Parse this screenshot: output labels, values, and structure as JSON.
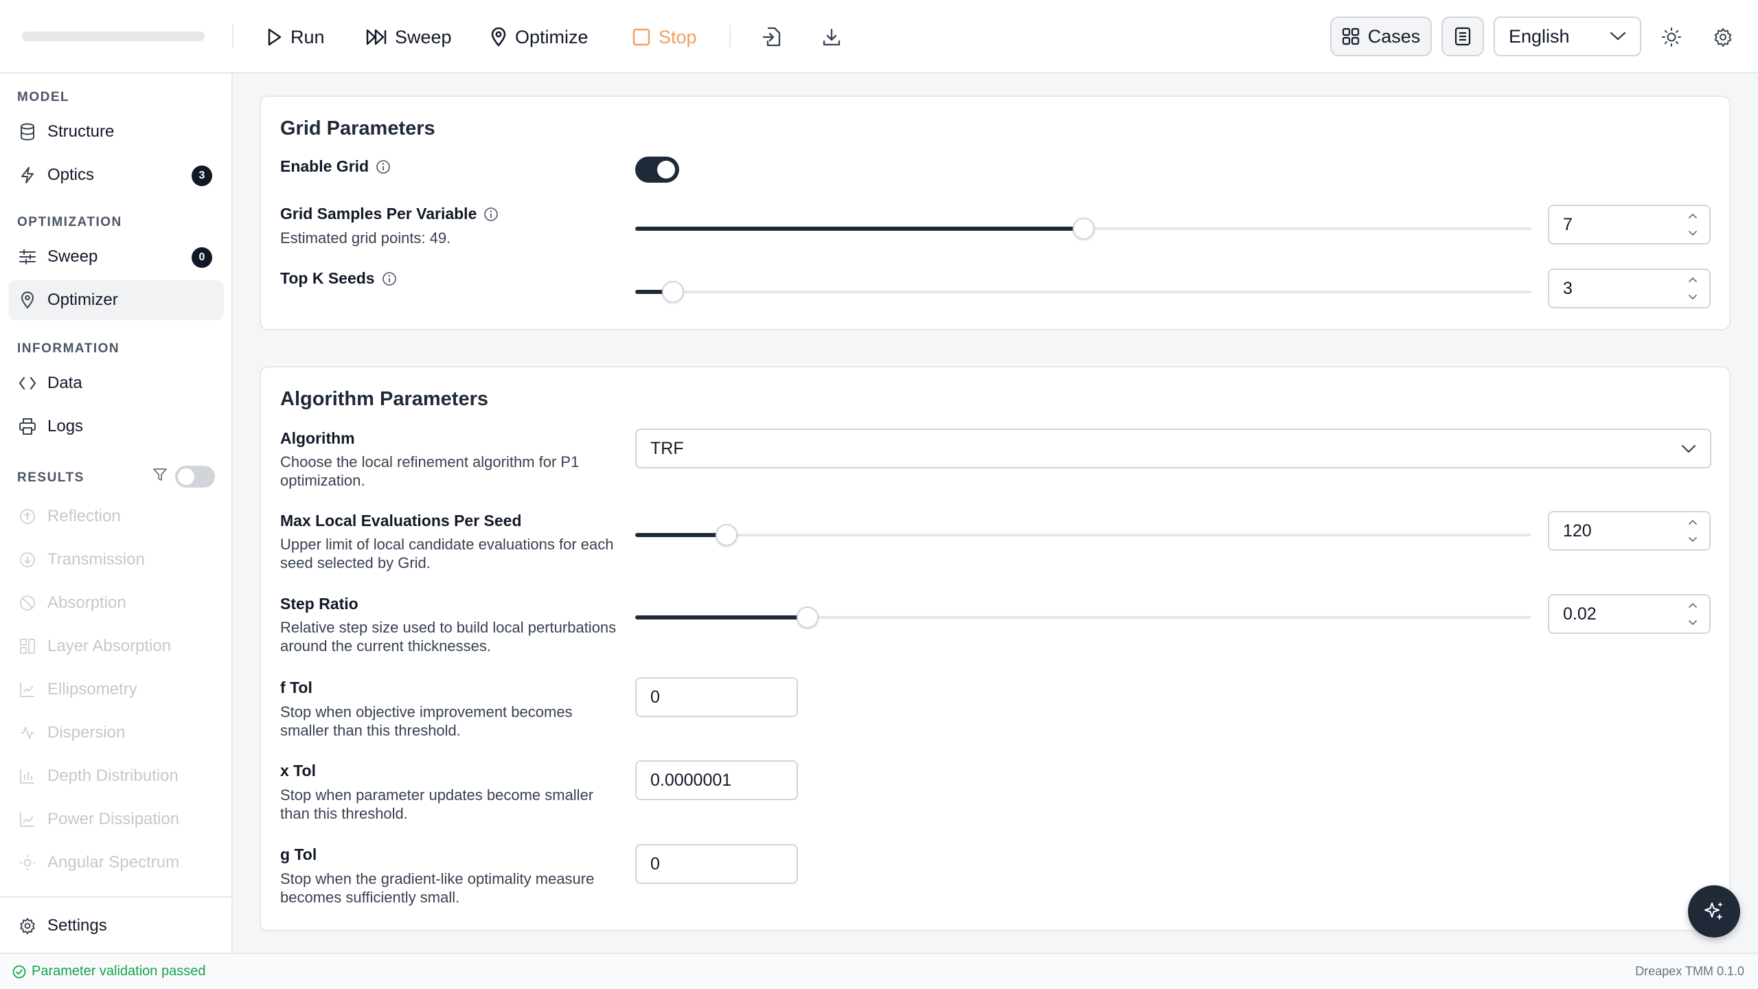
{
  "toolbar": {
    "run": "Run",
    "sweep": "Sweep",
    "optimize": "Optimize",
    "stop": "Stop",
    "cases": "Cases",
    "language": "English"
  },
  "sidebar": {
    "model_section": "MODEL",
    "structure": "Structure",
    "optics": "Optics",
    "optics_badge": "3",
    "optimization_section": "OPTIMIZATION",
    "sweep": "Sweep",
    "sweep_badge": "0",
    "optimizer": "Optimizer",
    "information_section": "INFORMATION",
    "data": "Data",
    "logs": "Logs",
    "results_section": "RESULTS",
    "results": [
      "Reflection",
      "Transmission",
      "Absorption",
      "Layer Absorption",
      "Ellipsometry",
      "Dispersion",
      "Depth Distribution",
      "Power Dissipation",
      "Angular Spectrum"
    ],
    "settings": "Settings"
  },
  "grid_card": {
    "title": "Grid Parameters",
    "enable_grid_label": "Enable Grid",
    "enable_grid_on": true,
    "samples_label": "Grid Samples Per Variable",
    "samples_desc": "Estimated grid points: 49.",
    "samples_value": "7",
    "samples_fraction": 0.5,
    "topk_label": "Top K Seeds",
    "topk_value": "3",
    "topk_fraction": 0.042
  },
  "algo_card": {
    "title": "Algorithm Parameters",
    "algorithm_label": "Algorithm",
    "algorithm_desc": "Choose the local refinement algorithm for P1 optimization.",
    "algorithm_value": "TRF",
    "max_eval_label": "Max Local Evaluations Per Seed",
    "max_eval_desc": "Upper limit of local candidate evaluations for each seed selected by Grid.",
    "max_eval_value": "120",
    "max_eval_fraction": 0.102,
    "step_label": "Step Ratio",
    "step_desc": "Relative step size used to build local perturbations around the current thicknesses.",
    "step_value": "0.02",
    "step_fraction": 0.192,
    "ftol_label": "f Tol",
    "ftol_desc": "Stop when objective improvement becomes smaller than this threshold.",
    "ftol_value": "0",
    "xtol_label": "x Tol",
    "xtol_desc": "Stop when parameter updates become smaller than this threshold.",
    "xtol_value": "0.0000001",
    "gtol_label": "g Tol",
    "gtol_desc": "Stop when the gradient-like optimality measure becomes sufficiently small.",
    "gtol_value": "0"
  },
  "status": {
    "message": "Parameter validation passed",
    "version": "Dreapex TMM 0.1.0"
  },
  "colors": {
    "accent": "#1f2937",
    "stop": "#f0a060",
    "ok": "#16a34a"
  }
}
